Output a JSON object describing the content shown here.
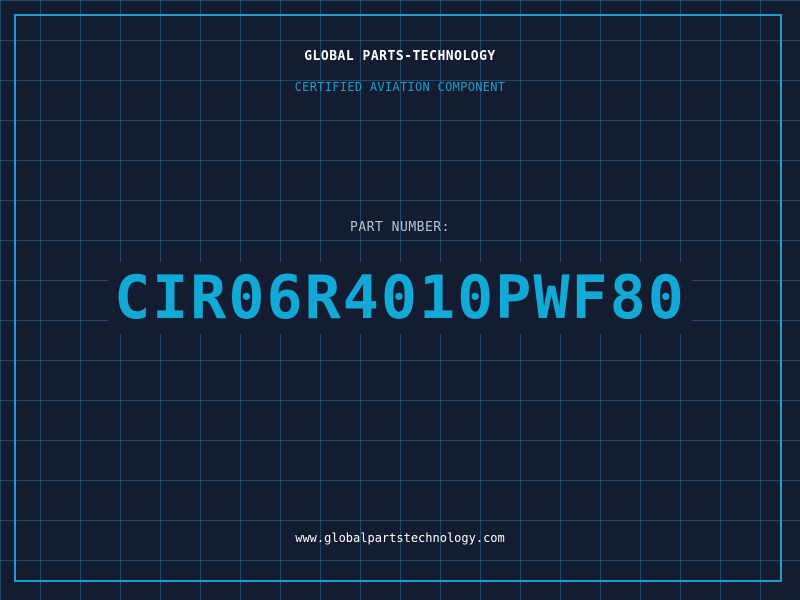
{
  "header": {
    "company": "GLOBAL PARTS-TECHNOLOGY",
    "subtitle": "CERTIFIED AVIATION COMPONENT"
  },
  "part": {
    "label": "PART NUMBER:",
    "number": "CIR06R4010PWF80"
  },
  "footer": {
    "website": "www.globalpartstechnology.com"
  },
  "colors": {
    "background": "#131c30",
    "grid": "#286e96",
    "accent": "#13a9d6",
    "frame": "#1a9fcf",
    "label": "#b7c2d2",
    "text": "#ffffff"
  }
}
